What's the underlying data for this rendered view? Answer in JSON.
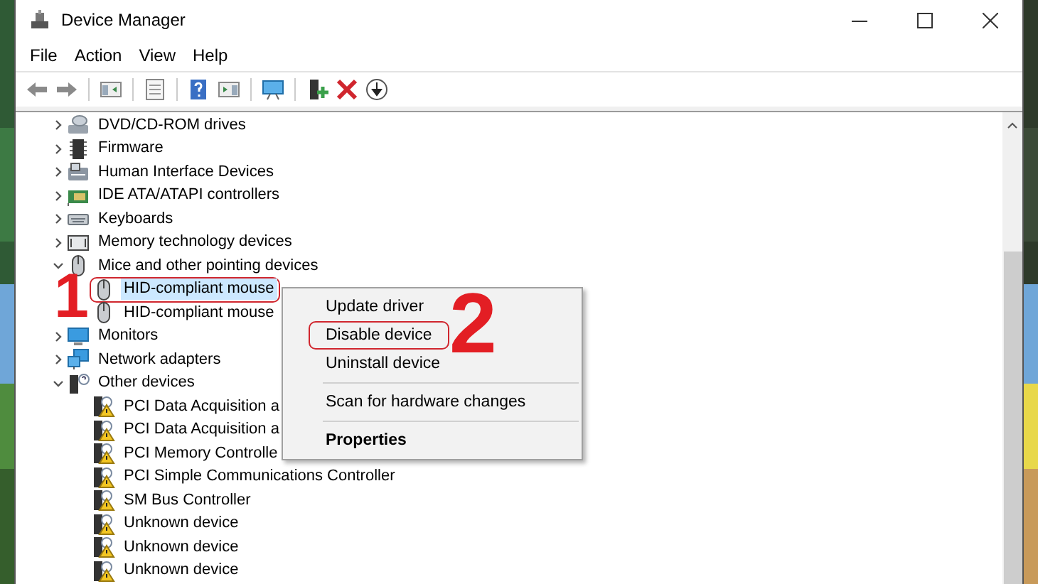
{
  "window": {
    "title": "Device Manager"
  },
  "menu_bar": [
    "File",
    "Action",
    "View",
    "Help"
  ],
  "tree": [
    {
      "label": "DVD/CD-ROM drives",
      "kind": "disc",
      "expanded": false,
      "selected": false
    },
    {
      "label": "Firmware",
      "kind": "chip",
      "expanded": false,
      "selected": false
    },
    {
      "label": "Human Interface Devices",
      "kind": "hid",
      "expanded": false,
      "selected": false
    },
    {
      "label": "IDE ATA/ATAPI controllers",
      "kind": "controller",
      "expanded": false,
      "selected": false
    },
    {
      "label": "Keyboards",
      "kind": "keyboard",
      "expanded": false,
      "selected": false
    },
    {
      "label": "Memory technology devices",
      "kind": "memory",
      "expanded": false,
      "selected": false
    },
    {
      "label": "Mice and other pointing devices",
      "kind": "mouse",
      "expanded": true,
      "selected": false,
      "children": [
        {
          "label": "HID-compliant mouse",
          "kind": "mouse",
          "selected": true,
          "outlined": true
        },
        {
          "label": "HID-compliant mouse",
          "kind": "mouse",
          "selected": false,
          "outlined": false
        }
      ]
    },
    {
      "label": "Monitors",
      "kind": "monitor",
      "expanded": false,
      "selected": false
    },
    {
      "label": "Network adapters",
      "kind": "network",
      "expanded": false,
      "selected": false
    },
    {
      "label": "Other devices",
      "kind": "unknown",
      "expanded": true,
      "selected": false,
      "children": [
        {
          "label": "PCI Data Acquisition a",
          "kind": "warning",
          "selected": false,
          "outlined": false
        },
        {
          "label": "PCI Data Acquisition a",
          "kind": "warning",
          "selected": false,
          "outlined": false
        },
        {
          "label": "PCI Memory Controlle",
          "kind": "warning",
          "selected": false,
          "outlined": false
        },
        {
          "label": "PCI Simple Communications Controller",
          "kind": "warning",
          "selected": false,
          "outlined": false
        },
        {
          "label": "SM Bus Controller",
          "kind": "warning",
          "selected": false,
          "outlined": false
        },
        {
          "label": "Unknown device",
          "kind": "warning",
          "selected": false,
          "outlined": false
        },
        {
          "label": "Unknown device",
          "kind": "warning",
          "selected": false,
          "outlined": false
        },
        {
          "label": "Unknown device",
          "kind": "warning",
          "selected": false,
          "outlined": false
        }
      ]
    }
  ],
  "context_menu": [
    {
      "kind": "item",
      "label": "Update driver",
      "outlined": false,
      "default": false
    },
    {
      "kind": "item",
      "label": "Disable device",
      "outlined": true,
      "default": false
    },
    {
      "kind": "item",
      "label": "Uninstall device",
      "outlined": false,
      "default": false
    },
    {
      "kind": "separator"
    },
    {
      "kind": "item",
      "label": "Scan for hardware changes",
      "outlined": false,
      "default": false
    },
    {
      "kind": "separator"
    },
    {
      "kind": "item",
      "label": "Properties",
      "outlined": false,
      "default": true
    }
  ],
  "step_numbers": [
    "1",
    "2"
  ]
}
